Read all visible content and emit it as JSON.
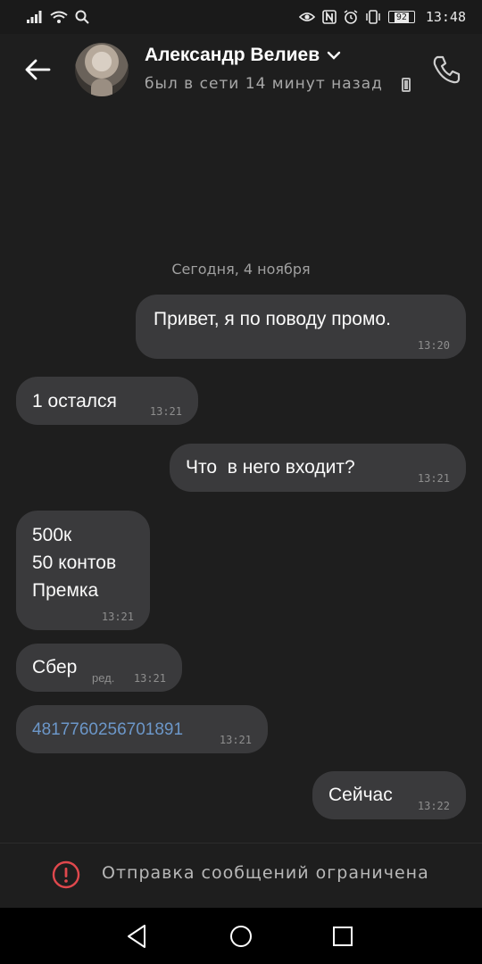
{
  "status_bar": {
    "time": "13:48",
    "battery": "92",
    "left_icons": [
      "signal-icon",
      "wifi-icon",
      "search-icon"
    ],
    "right_icons": [
      "eye-icon",
      "nfc-icon",
      "alarm-icon",
      "vibrate-icon"
    ]
  },
  "header": {
    "contact_name": "Александр Велиев",
    "status": "был в сети 14 минут назад"
  },
  "chat": {
    "date_separator": "Сегодня, 4 ноября",
    "messages": [
      {
        "direction": "outgoing",
        "text": "Привет, я по поводу промо.",
        "time": "13:20"
      },
      {
        "direction": "incoming",
        "text": "1 остался",
        "time": "13:21"
      },
      {
        "direction": "outgoing",
        "text": "Что  в него входит?",
        "time": "13:21"
      },
      {
        "direction": "incoming",
        "text": "500к\n50 контов\nПремка",
        "time": "13:21"
      },
      {
        "direction": "incoming",
        "text": "Сбер",
        "edited": "ред.",
        "time": "13:21"
      },
      {
        "direction": "incoming",
        "text": "4817760256701891",
        "time": "13:21",
        "is_link": true
      },
      {
        "direction": "outgoing",
        "text": "Сейчас",
        "time": "13:22"
      }
    ]
  },
  "footer": {
    "restriction_text": "Отправка сообщений ограничена"
  },
  "colors": {
    "background": "#1e1e1e",
    "bubble": "#3a3a3c",
    "link": "#6c97c9",
    "warning": "#e0484d"
  }
}
